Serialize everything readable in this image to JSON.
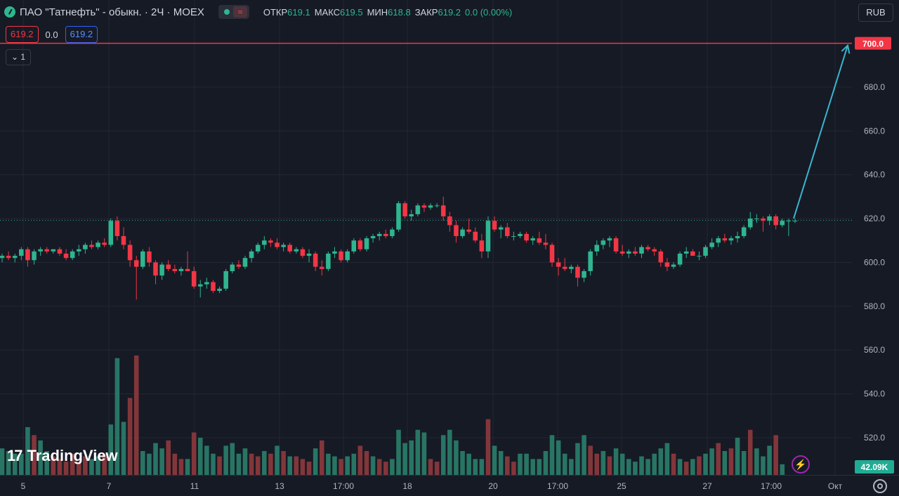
{
  "header": {
    "title": "ПАО \"Татнефть\" - обыкн. · 2Ч · MOEX",
    "wave_icon": "≈",
    "ohlc": [
      {
        "k": "ОТКР",
        "v": "619.1"
      },
      {
        "k": "МАКС",
        "v": "619.5"
      },
      {
        "k": "МИН",
        "v": "618.8"
      },
      {
        "k": "ЗАКР",
        "v": "619.2"
      },
      {
        "k": "",
        "v": "0.0 (0.00%)"
      }
    ]
  },
  "order": {
    "bid": "619.2",
    "spread": "0.0",
    "ask": "619.2"
  },
  "interval_box": "1",
  "currency": "RUB",
  "branding": {
    "logo_mark": "17",
    "name": "TradingView"
  },
  "bolt_icon": "⚡",
  "colors": {
    "up": "#2fb58f",
    "down": "#f23645",
    "bg": "#161a25",
    "grid": "#232733",
    "arrow": "#3ab5cf",
    "hline": "#f23645"
  },
  "chart_data": {
    "type": "candlestick",
    "y_ticks": [
      "520.0",
      "540.0",
      "560.0",
      "580.0",
      "600.0",
      "620.0",
      "640.0",
      "660.0",
      "680.0"
    ],
    "x_ticks": [
      "5",
      "7",
      "11",
      "13",
      "17:00",
      "18",
      "20",
      "17:00",
      "25",
      "27",
      "17:00",
      "Окт"
    ],
    "ylim": [
      503,
      705
    ],
    "hline": {
      "price": 700.0,
      "label": "700.0"
    },
    "current_price": 619.2,
    "volume_label": "42.09K",
    "ohlc": [
      [
        602,
        604,
        600,
        603
      ],
      [
        603,
        605,
        601,
        602
      ],
      [
        602,
        604,
        600,
        603
      ],
      [
        603,
        607,
        601,
        606
      ],
      [
        606,
        607,
        598,
        601
      ],
      [
        601,
        606,
        599,
        605
      ],
      [
        605,
        607,
        603,
        606
      ],
      [
        606,
        607,
        604,
        605
      ],
      [
        605,
        606,
        604,
        606
      ],
      [
        606,
        607,
        603,
        604
      ],
      [
        604,
        606,
        601,
        602
      ],
      [
        602,
        606,
        601,
        605
      ],
      [
        605,
        608,
        603,
        606
      ],
      [
        606,
        609,
        604,
        608
      ],
      [
        608,
        610,
        606,
        607
      ],
      [
        607,
        610,
        606,
        609
      ],
      [
        609,
        611,
        607,
        608
      ],
      [
        608,
        620,
        607,
        619
      ],
      [
        619,
        621,
        610,
        612
      ],
      [
        612,
        616,
        606,
        608
      ],
      [
        608,
        610,
        598,
        601
      ],
      [
        601,
        603,
        583,
        598
      ],
      [
        598,
        606,
        597,
        605
      ],
      [
        605,
        607,
        598,
        600
      ],
      [
        600,
        601,
        590,
        594
      ],
      [
        594,
        600,
        592,
        599
      ],
      [
        599,
        601,
        596,
        597
      ],
      [
        597,
        599,
        595,
        596
      ],
      [
        596,
        598,
        594,
        597
      ],
      [
        597,
        605,
        596,
        596
      ],
      [
        596,
        598,
        588,
        589
      ],
      [
        589,
        592,
        584,
        590
      ],
      [
        590,
        593,
        588,
        591
      ],
      [
        591,
        592,
        586,
        587
      ],
      [
        587,
        589,
        586,
        588
      ],
      [
        588,
        597,
        587,
        596
      ],
      [
        596,
        600,
        595,
        599
      ],
      [
        599,
        601,
        597,
        598
      ],
      [
        598,
        603,
        597,
        602
      ],
      [
        602,
        606,
        600,
        605
      ],
      [
        605,
        609,
        604,
        608
      ],
      [
        608,
        612,
        606,
        610
      ],
      [
        610,
        611,
        607,
        609
      ],
      [
        609,
        611,
        606,
        607
      ],
      [
        607,
        609,
        605,
        608
      ],
      [
        608,
        609,
        604,
        605
      ],
      [
        605,
        607,
        604,
        606
      ],
      [
        606,
        607,
        602,
        603
      ],
      [
        603,
        606,
        600,
        604
      ],
      [
        604,
        605,
        596,
        598
      ],
      [
        598,
        601,
        594,
        597
      ],
      [
        597,
        605,
        596,
        604
      ],
      [
        604,
        607,
        602,
        605
      ],
      [
        605,
        606,
        600,
        601
      ],
      [
        601,
        606,
        600,
        605
      ],
      [
        605,
        611,
        604,
        610
      ],
      [
        610,
        611,
        605,
        606
      ],
      [
        606,
        612,
        605,
        611
      ],
      [
        611,
        613,
        609,
        612
      ],
      [
        612,
        614,
        610,
        613
      ],
      [
        613,
        615,
        611,
        612
      ],
      [
        612,
        616,
        611,
        615
      ],
      [
        615,
        628,
        614,
        627
      ],
      [
        627,
        628,
        620,
        621
      ],
      [
        621,
        624,
        619,
        622
      ],
      [
        622,
        627,
        621,
        626
      ],
      [
        626,
        627,
        623,
        625
      ],
      [
        625,
        627,
        624,
        626
      ],
      [
        626,
        627,
        625,
        626
      ],
      [
        626,
        630,
        619,
        621
      ],
      [
        621,
        623,
        614,
        617
      ],
      [
        617,
        619,
        609,
        612
      ],
      [
        612,
        616,
        611,
        615
      ],
      [
        615,
        620,
        613,
        614
      ],
      [
        614,
        616,
        609,
        610
      ],
      [
        610,
        613,
        602,
        605
      ],
      [
        605,
        621,
        602,
        619
      ],
      [
        619,
        621,
        614,
        615
      ],
      [
        615,
        617,
        611,
        616
      ],
      [
        616,
        618,
        611,
        612
      ],
      [
        612,
        614,
        610,
        612
      ],
      [
        612,
        614,
        611,
        613
      ],
      [
        613,
        614,
        609,
        610
      ],
      [
        610,
        612,
        608,
        611
      ],
      [
        611,
        614,
        608,
        609
      ],
      [
        609,
        613,
        606,
        608
      ],
      [
        608,
        609,
        598,
        600
      ],
      [
        600,
        602,
        594,
        598
      ],
      [
        598,
        602,
        596,
        597
      ],
      [
        597,
        599,
        595,
        598
      ],
      [
        598,
        599,
        589,
        593
      ],
      [
        593,
        597,
        591,
        596
      ],
      [
        596,
        606,
        594,
        605
      ],
      [
        605,
        610,
        603,
        608
      ],
      [
        608,
        611,
        606,
        610
      ],
      [
        610,
        612,
        607,
        611
      ],
      [
        611,
        612,
        604,
        605
      ],
      [
        605,
        608,
        603,
        604
      ],
      [
        604,
        606,
        602,
        605
      ],
      [
        605,
        607,
        603,
        604
      ],
      [
        604,
        608,
        602,
        607
      ],
      [
        607,
        608,
        605,
        606
      ],
      [
        606,
        607,
        603,
        605
      ],
      [
        605,
        606,
        598,
        600
      ],
      [
        600,
        602,
        596,
        598
      ],
      [
        598,
        600,
        597,
        599
      ],
      [
        599,
        605,
        598,
        604
      ],
      [
        604,
        607,
        602,
        605
      ],
      [
        605,
        606,
        603,
        603
      ],
      [
        603,
        605,
        601,
        603
      ],
      [
        603,
        608,
        602,
        607
      ],
      [
        607,
        611,
        606,
        609
      ],
      [
        609,
        612,
        607,
        611
      ],
      [
        611,
        613,
        609,
        610
      ],
      [
        610,
        612,
        608,
        611
      ],
      [
        611,
        614,
        609,
        612
      ],
      [
        612,
        617,
        611,
        616
      ],
      [
        616,
        623,
        615,
        620
      ],
      [
        620,
        622,
        618,
        620
      ],
      [
        620,
        621,
        614,
        619
      ],
      [
        619,
        622,
        617,
        621
      ],
      [
        621,
        622,
        615,
        617
      ],
      [
        617,
        620,
        616,
        619
      ],
      [
        619,
        620,
        612,
        619
      ],
      [
        619,
        620,
        618,
        619
      ]
    ],
    "volume": [
      [
        10,
        1
      ],
      [
        9,
        1
      ],
      [
        8,
        1
      ],
      [
        8,
        1
      ],
      [
        18,
        1
      ],
      [
        15,
        0
      ],
      [
        13,
        1
      ],
      [
        9,
        1
      ],
      [
        7,
        0
      ],
      [
        6,
        0
      ],
      [
        5,
        0
      ],
      [
        8,
        0
      ],
      [
        5,
        0
      ],
      [
        7,
        0
      ],
      [
        6,
        1
      ],
      [
        7,
        1
      ],
      [
        8,
        0
      ],
      [
        19,
        1
      ],
      [
        44,
        1
      ],
      [
        20,
        1
      ],
      [
        29,
        0
      ],
      [
        45,
        0
      ],
      [
        9,
        1
      ],
      [
        8,
        1
      ],
      [
        12,
        1
      ],
      [
        10,
        1
      ],
      [
        13,
        0
      ],
      [
        8,
        0
      ],
      [
        6,
        0
      ],
      [
        6,
        1
      ],
      [
        16,
        0
      ],
      [
        14,
        1
      ],
      [
        11,
        1
      ],
      [
        8,
        1
      ],
      [
        7,
        0
      ],
      [
        11,
        1
      ],
      [
        12,
        1
      ],
      [
        8,
        1
      ],
      [
        10,
        1
      ],
      [
        8,
        0
      ],
      [
        7,
        0
      ],
      [
        9,
        1
      ],
      [
        8,
        0
      ],
      [
        11,
        1
      ],
      [
        9,
        0
      ],
      [
        7,
        1
      ],
      [
        7,
        0
      ],
      [
        6,
        0
      ],
      [
        5,
        0
      ],
      [
        10,
        1
      ],
      [
        13,
        0
      ],
      [
        8,
        1
      ],
      [
        7,
        1
      ],
      [
        6,
        0
      ],
      [
        7,
        1
      ],
      [
        8,
        1
      ],
      [
        11,
        0
      ],
      [
        9,
        0
      ],
      [
        7,
        1
      ],
      [
        6,
        0
      ],
      [
        5,
        0
      ],
      [
        6,
        1
      ],
      [
        17,
        1
      ],
      [
        12,
        1
      ],
      [
        13,
        1
      ],
      [
        17,
        1
      ],
      [
        16,
        1
      ],
      [
        6,
        0
      ],
      [
        5,
        0
      ],
      [
        15,
        1
      ],
      [
        17,
        1
      ],
      [
        13,
        1
      ],
      [
        9,
        1
      ],
      [
        8,
        1
      ],
      [
        6,
        1
      ],
      [
        6,
        1
      ],
      [
        21,
        0
      ],
      [
        11,
        1
      ],
      [
        9,
        1
      ],
      [
        7,
        0
      ],
      [
        5,
        0
      ],
      [
        8,
        1
      ],
      [
        8,
        1
      ],
      [
        6,
        1
      ],
      [
        6,
        1
      ],
      [
        9,
        1
      ],
      [
        15,
        1
      ],
      [
        13,
        1
      ],
      [
        8,
        1
      ],
      [
        6,
        1
      ],
      [
        12,
        1
      ],
      [
        15,
        1
      ],
      [
        11,
        0
      ],
      [
        8,
        0
      ],
      [
        9,
        1
      ],
      [
        7,
        0
      ],
      [
        10,
        1
      ],
      [
        8,
        1
      ],
      [
        6,
        1
      ],
      [
        5,
        1
      ],
      [
        7,
        1
      ],
      [
        6,
        1
      ],
      [
        8,
        1
      ],
      [
        10,
        1
      ],
      [
        12,
        1
      ],
      [
        8,
        0
      ],
      [
        6,
        1
      ],
      [
        5,
        0
      ],
      [
        6,
        1
      ],
      [
        7,
        0
      ],
      [
        8,
        1
      ],
      [
        10,
        1
      ],
      [
        12,
        0
      ],
      [
        9,
        1
      ],
      [
        10,
        0
      ],
      [
        14,
        1
      ],
      [
        9,
        1
      ],
      [
        17,
        0
      ],
      [
        10,
        1
      ],
      [
        7,
        1
      ],
      [
        11,
        1
      ],
      [
        15,
        0
      ],
      [
        4,
        1
      ]
    ]
  }
}
